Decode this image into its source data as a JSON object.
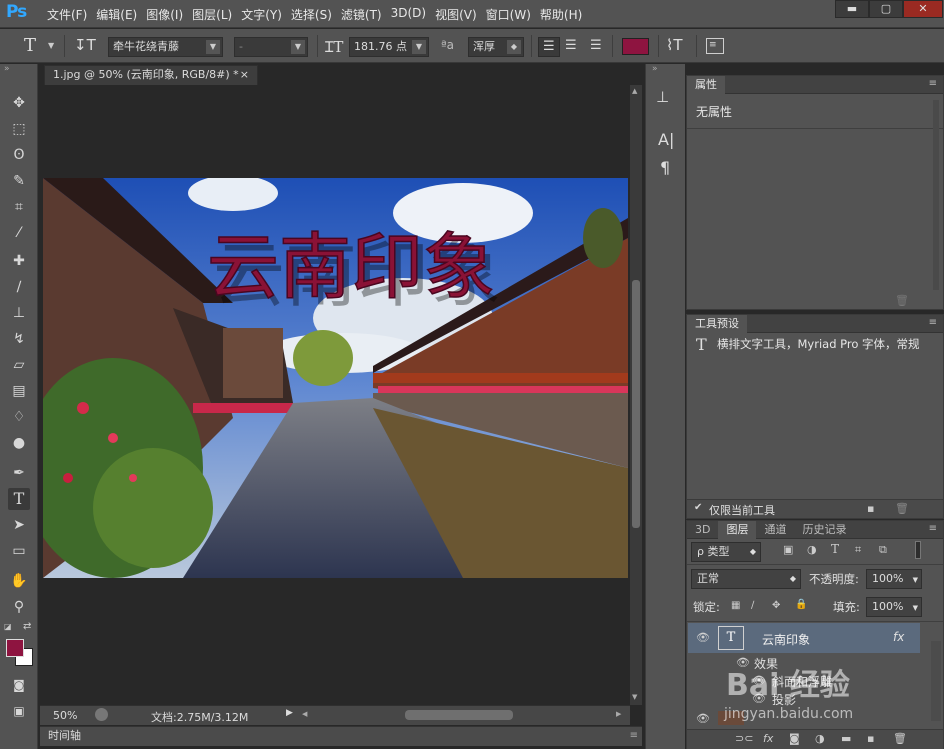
{
  "app": {
    "logo": "Ps"
  },
  "menubar": {
    "items": [
      "文件(F)",
      "编辑(E)",
      "图像(I)",
      "图层(L)",
      "文字(Y)",
      "选择(S)",
      "滤镜(T)",
      "3D(D)",
      "视图(V)",
      "窗口(W)",
      "帮助(H)"
    ]
  },
  "options": {
    "tool_glyph": "T",
    "font_family": "牵牛花绕青藤",
    "font_style": "-",
    "font_size": "181.76 点",
    "aa_label": "ªa",
    "antialias": "浑厚",
    "text_color": "#8e1440"
  },
  "document": {
    "tab_title": "1.jpg @ 50% (云南印象, RGB/8#) *",
    "close": "×",
    "canvas_text": "云南印象",
    "zoom": "50%",
    "doc_info": "文档:2.75M/3.12M"
  },
  "timeline": {
    "label": "时间轴"
  },
  "properties": {
    "title": "属性",
    "content": "无属性"
  },
  "tool_presets": {
    "title": "工具预设",
    "item_glyph": "T",
    "item": "横排文字工具，Myriad Pro 字体，常规",
    "current_only": "仅限当前工具"
  },
  "layers": {
    "tabs": [
      "3D",
      "图层",
      "通道",
      "历史记录"
    ],
    "filter": "ρ 类型",
    "blend_mode": "正常",
    "opacity_label": "不透明度:",
    "opacity": "100%",
    "lock_label": "锁定:",
    "fill_label": "填充:",
    "fill": "100%",
    "rows": [
      {
        "name": "云南印象",
        "fx": "fx",
        "thumb": "T"
      },
      {
        "name": "效果"
      },
      {
        "name": "斜面和浮雕"
      },
      {
        "name": "投影"
      }
    ]
  },
  "watermark": {
    "text": "Bai 经验",
    "sub": "jingyan.baidu.com"
  },
  "colors": {
    "foreground": "#8e1440",
    "background": "#ffffff",
    "accent": "#31a8ff"
  }
}
